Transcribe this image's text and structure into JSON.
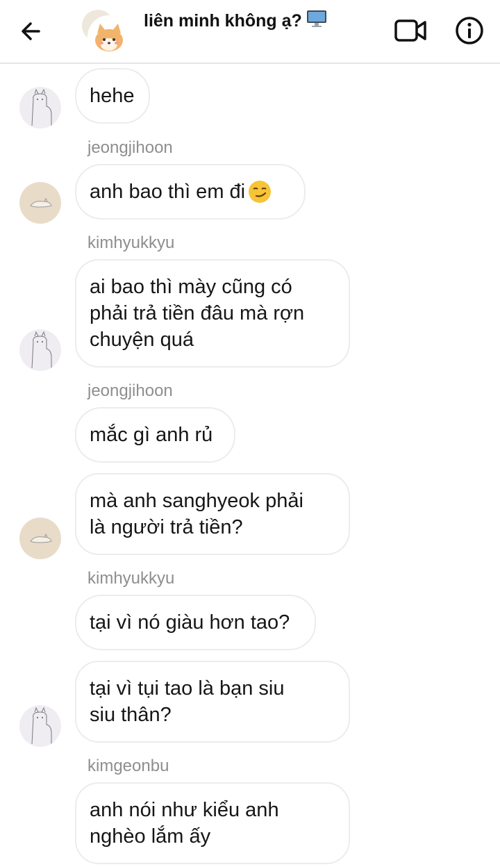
{
  "header": {
    "title": "liên minh không ạ?",
    "title_emoji": "desktop-computer-icon"
  },
  "messages": [
    {
      "sender": "",
      "text": "hehe",
      "avatar": "alpaca"
    },
    {
      "sender": "jeongjihoon",
      "text": "anh bao thì em đi",
      "emoji": "smirk-emoji",
      "avatar": "cat"
    },
    {
      "sender": "kimhyukkyu",
      "lines": [
        "ai bao thì mày cũng có",
        "phải trả tiền đâu mà rợn",
        "chuyện quá"
      ],
      "avatar": "alpaca"
    },
    {
      "sender": "jeongjihoon",
      "text": "mắc gì anh rủ"
    },
    {
      "sender": "",
      "lines": [
        "mà anh sanghyeok phải",
        "là người trả tiền?"
      ],
      "avatar": "cat"
    },
    {
      "sender": "kimhyukkyu",
      "text": "tại vì nó giàu hơn tao?"
    },
    {
      "sender": "",
      "lines": [
        "tại vì tụi tao là bạn siu",
        "siu thân?"
      ],
      "avatar": "alpaca"
    },
    {
      "sender": "kimgeonbu",
      "lines": [
        "anh nói như kiểu anh",
        "nghèo lắm ấy"
      ]
    }
  ],
  "colors": {
    "bubble_border": "#ececec",
    "sender_text": "#8e8e8e",
    "header_divider": "#e6e6e6"
  }
}
